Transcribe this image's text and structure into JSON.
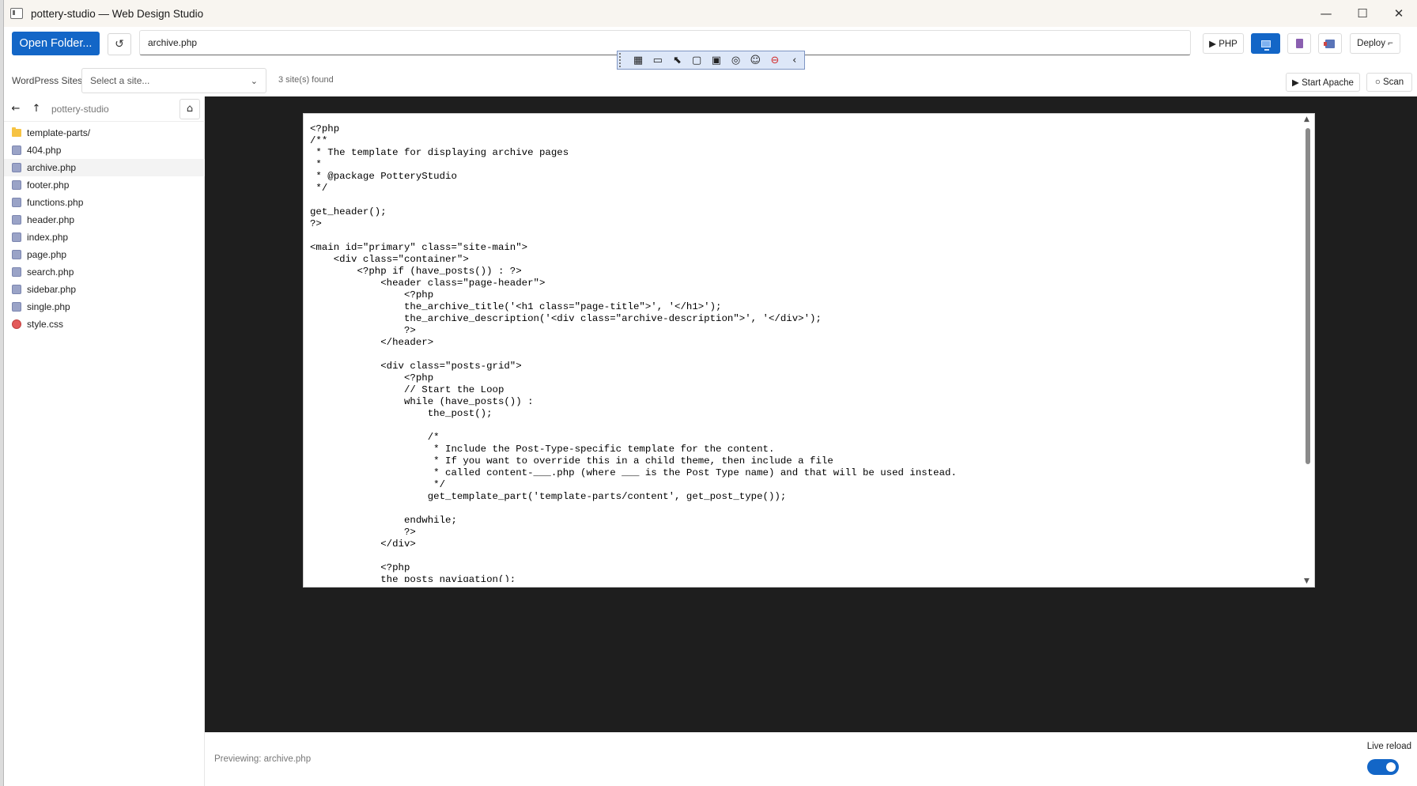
{
  "window": {
    "title": "pottery-studio — Web Design Studio",
    "minimize": "—",
    "maximize": "☐",
    "close": "✕"
  },
  "toolbar": {
    "open_folder_label": "Open Folder...",
    "refresh_glyph": "↺",
    "path_value": "archive.php",
    "php_label": "▶ PHP",
    "deploy_label": "Deploy ⌐"
  },
  "devbar": {
    "icons": [
      "inspect-icon",
      "camera-icon",
      "select-icon",
      "frame-icon",
      "device-icon",
      "paint-icon",
      "accessibility-icon",
      "stop-icon",
      "collapse-icon"
    ],
    "glyphs": [
      "▦",
      "▭",
      "⬉",
      "▢",
      "▣",
      "◎",
      "☺",
      "⊖",
      "‹"
    ]
  },
  "sites": {
    "label": "WordPress Sites",
    "select_placeholder": "Select a site...",
    "found_text": "3 site(s) found",
    "start_apache_label": "▶ Start Apache",
    "scan_label": "○ Scan"
  },
  "sidebar": {
    "back_glyph": "←",
    "up_glyph": "↑",
    "path": "pottery-studio",
    "home_glyph": "⌂",
    "files": [
      {
        "name": "template-parts/",
        "type": "folder"
      },
      {
        "name": "404.php",
        "type": "php"
      },
      {
        "name": "archive.php",
        "type": "php",
        "selected": true
      },
      {
        "name": "footer.php",
        "type": "php"
      },
      {
        "name": "functions.php",
        "type": "php"
      },
      {
        "name": "header.php",
        "type": "php"
      },
      {
        "name": "index.php",
        "type": "php"
      },
      {
        "name": "page.php",
        "type": "php"
      },
      {
        "name": "search.php",
        "type": "php"
      },
      {
        "name": "sidebar.php",
        "type": "php"
      },
      {
        "name": "single.php",
        "type": "php"
      },
      {
        "name": "style.css",
        "type": "css"
      }
    ]
  },
  "code_lines": [
    "<?php",
    "/**",
    " * The template for displaying archive pages",
    " *",
    " * @package PotteryStudio",
    " */",
    "",
    "get_header();",
    "?>",
    "",
    "<main id=\"primary\" class=\"site-main\">",
    "    <div class=\"container\">",
    "        <?php if (have_posts()) : ?>",
    "            <header class=\"page-header\">",
    "                <?php",
    "                the_archive_title('<h1 class=\"page-title\">', '</h1>');",
    "                the_archive_description('<div class=\"archive-description\">', '</div>');",
    "                ?>",
    "            </header>",
    "",
    "            <div class=\"posts-grid\">",
    "                <?php",
    "                // Start the Loop",
    "                while (have_posts()) :",
    "                    the_post();",
    "",
    "                    /*",
    "                     * Include the Post-Type-specific template for the content.",
    "                     * If you want to override this in a child theme, then include a file",
    "                     * called content-___.php (where ___ is the Post Type name) and that will be used instead.",
    "                     */",
    "                    get_template_part('template-parts/content', get_post_type());",
    "",
    "                endwhile;",
    "                ?>",
    "            </div>",
    "",
    "            <?php",
    "            the_posts_navigation();"
  ],
  "scrollbar": {
    "up": "▲",
    "down": "▼"
  },
  "status": {
    "previewing": "Previewing: archive.php",
    "live_reload_label": "Live reload",
    "live_reload_on": true
  }
}
